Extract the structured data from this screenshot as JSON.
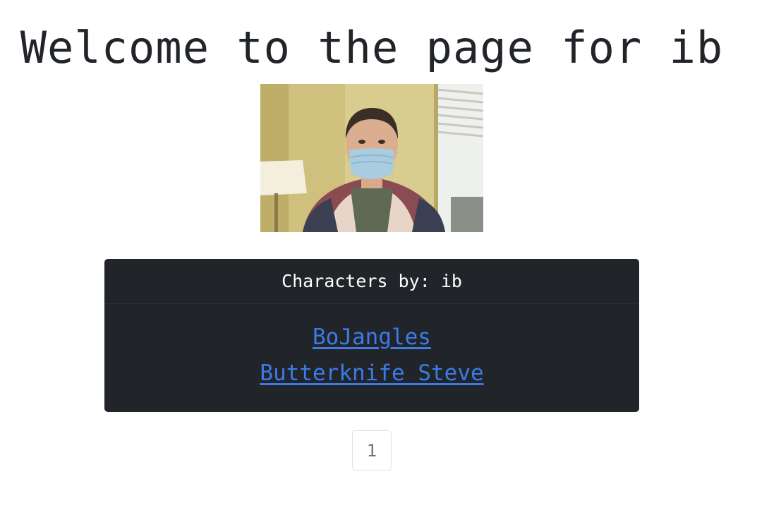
{
  "page": {
    "title": "Welcome to the page for ib"
  },
  "profile": {
    "photo_icon": "profile-photo"
  },
  "characters_card": {
    "header": "Characters by: ib",
    "characters": [
      {
        "name": "BoJangles"
      },
      {
        "name": "Butterknife Steve"
      }
    ]
  },
  "pagination": {
    "current_page": "1"
  },
  "colors": {
    "link": "#3c7ae6",
    "card_bg": "#212529",
    "text": "#212529"
  }
}
